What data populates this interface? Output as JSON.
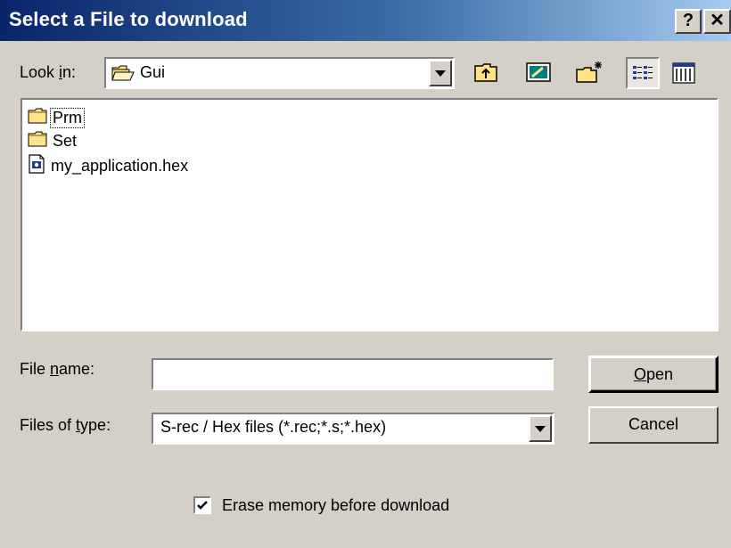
{
  "dialog": {
    "title": "Select a File to download",
    "help_glyph": "?",
    "close_glyph": "✕"
  },
  "lookin": {
    "label_pre": "Look ",
    "label_mnemonic": "i",
    "label_post": "n:",
    "value": "Gui"
  },
  "toolbar": {
    "icons": [
      "up-one-level-icon",
      "desktop-icon",
      "new-folder-icon",
      "list-view-icon",
      "details-view-icon"
    ]
  },
  "files": [
    {
      "name": "Prm",
      "icon": "folder-icon",
      "focused": true
    },
    {
      "name": "Set",
      "icon": "folder-icon",
      "focused": false
    },
    {
      "name": "my_application.hex",
      "icon": "hex-file-icon",
      "focused": false
    }
  ],
  "filename": {
    "label_pre": "File ",
    "label_mnemonic": "n",
    "label_post": "ame:",
    "value": ""
  },
  "filetype": {
    "label_pre": "Files of ",
    "label_mnemonic": "t",
    "label_post": "ype:",
    "value": "S-rec / Hex files (*.rec;*.s;*.hex)"
  },
  "buttons": {
    "open_mnemonic": "O",
    "open_rest": "pen",
    "cancel": "Cancel"
  },
  "erase": {
    "checked": true,
    "label": "Erase memory before download"
  },
  "colors": {
    "title_start": "#0a246a",
    "title_end": "#a6caf0",
    "face": "#d4d0c8",
    "folder": "#ffe38a"
  }
}
